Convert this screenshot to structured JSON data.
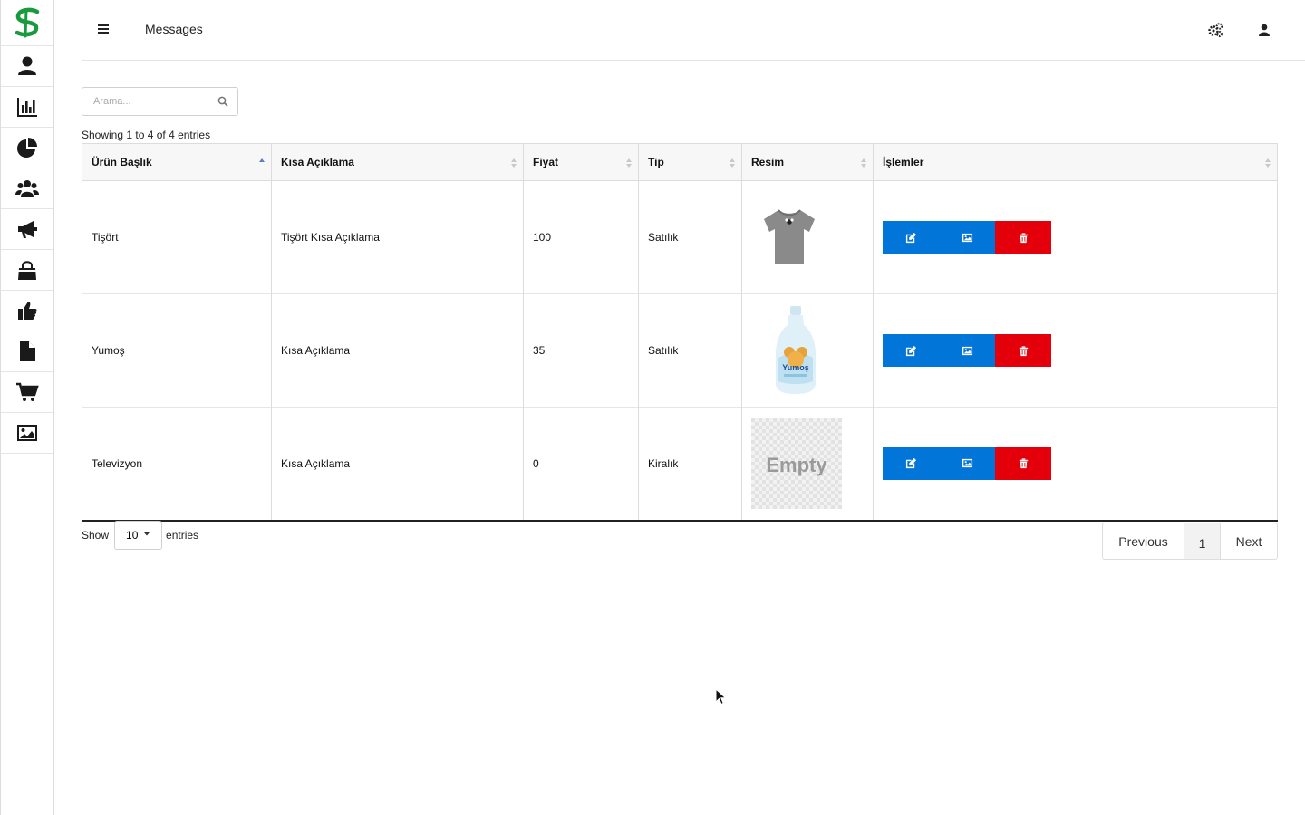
{
  "header": {
    "title": "Messages"
  },
  "search": {
    "placeholder": "Arama..."
  },
  "table": {
    "info": "Showing 1 to 4 of 4 entries",
    "columns": [
      "Ürün Başlık",
      "Kısa Açıklama",
      "Fiyat",
      "Tip",
      "Resim",
      "İşlemler"
    ],
    "rows": [
      {
        "title": "Tişört",
        "description": "Tişört Kısa Açıklama",
        "price": "100",
        "type": "Satılık",
        "image": "tshirt"
      },
      {
        "title": "Yumoş",
        "description": "Kısa Açıklama",
        "price": "35",
        "type": "Satılık",
        "image": "softener-bottle"
      },
      {
        "title": "Televizyon",
        "description": "Kısa Açıklama",
        "price": "0",
        "type": "Kiralık",
        "image": "empty"
      }
    ],
    "empty_image_text": "Empty",
    "bottle_label": "Yumoş"
  },
  "length_menu": {
    "show_label": "Show",
    "selected": "10",
    "entries_label": "entries"
  },
  "pagination": {
    "previous": "Previous",
    "current_page": "1",
    "next": "Next"
  },
  "colors": {
    "primary_button": "#0275d8",
    "danger_button": "#e3000b",
    "logo_green": "#1a9a3e"
  },
  "icons": {
    "sidebar": [
      "user-icon",
      "bar-chart-icon",
      "pie-chart-icon",
      "users-icon",
      "megaphone-icon",
      "shopping-bag-icon",
      "thumbs-up-icon",
      "file-icon",
      "cart-icon",
      "image-icon"
    ],
    "row_actions": [
      "edit-icon",
      "image-icon",
      "trash-icon"
    ]
  }
}
